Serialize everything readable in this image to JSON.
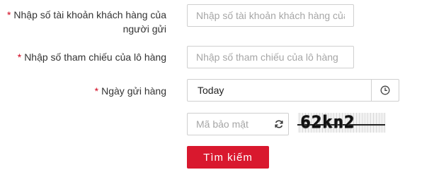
{
  "form": {
    "customer_account": {
      "required_mark": "*",
      "label_line1": "Nhập số tài khoản khách hàng của",
      "label_line2": "người gửi",
      "placeholder": "Nhập số tài khoản khách hàng của người gửi"
    },
    "shipment_reference": {
      "required_mark": "*",
      "label": "Nhập số tham chiếu của lô hàng",
      "placeholder": "Nhập số tham chiếu của lô hàng"
    },
    "ship_date": {
      "required_mark": "*",
      "label": "Ngày gửi hàng",
      "value": "Today",
      "icon": "clock-icon"
    },
    "captcha": {
      "placeholder": "Mã bảo mật",
      "refresh_icon": "refresh-icon",
      "image_text": "62kn2"
    },
    "search_button": "Tìm kiếm",
    "colors": {
      "required": "#d0021b",
      "button": "#d9182e",
      "border": "#cfcfcf"
    }
  }
}
